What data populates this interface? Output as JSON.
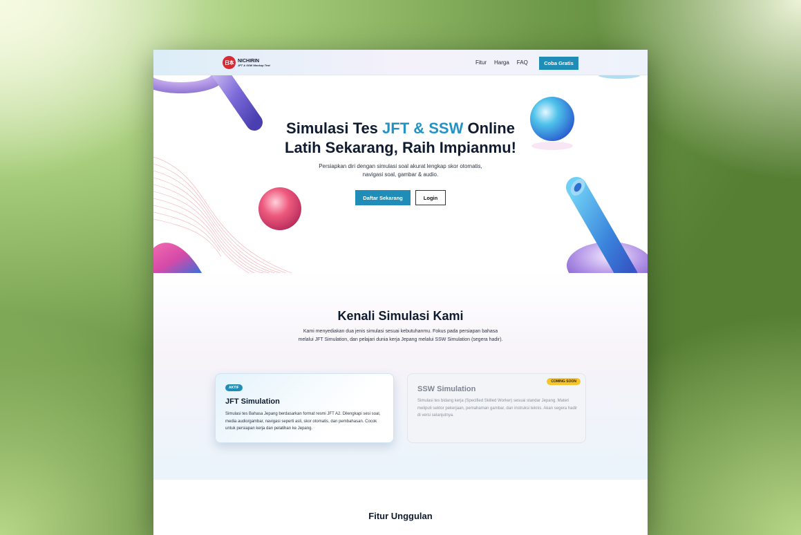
{
  "nav": {
    "logo_mark": "日本",
    "logo_name": "NICHIRIN",
    "logo_sub": "JFT & SSW Mockup Test",
    "links": [
      "Fitur",
      "Harga",
      "FAQ"
    ],
    "cta": "Coba Gratis"
  },
  "hero": {
    "title_prefix": "Simulasi Tes ",
    "title_accent": "JFT & SSW",
    "title_suffix": " Online",
    "title_line2": "Latih Sekarang, Raih Impianmu!",
    "subtitle_line1": "Persiapkan diri dengan simulasi soal akurat lengkap skor otomatis,",
    "subtitle_line2": "navigasi soal, gambar & audio.",
    "primary_button": "Daftar Sekarang",
    "secondary_button": "Login"
  },
  "about": {
    "title": "Kenali Simulasi Kami",
    "description": "Kami menyediakan dua jenis simulasi sesuai kebutuhanmu. Fokus pada persiapan bahasa melalui JFT Simulation, dan pelajari dunia kerja Jepang melalui SSW Simulation (segera hadir).",
    "cards": [
      {
        "badge": "AKTIF",
        "title": "JFT Simulation",
        "body": "Simulasi tes Bahasa Jepang berdasarkan format resmi JFT A2. Dilengkapi sesi soal, media audio/gambar, navigasi seperti asli, skor otomatis, dan pembahasan. Cocok untuk persiapan kerja dan pelatihan ke Jepang."
      },
      {
        "badge": "COMING SOON",
        "title": "SSW Simulation",
        "body": "Simulasi tes bidang kerja (Specified Skilled Worker) sesuai standar Jepang. Materi meliputi sektor pekerjaan, pemahaman gambar, dan instruksi teknis. Akan segera hadir di versi selanjutnya."
      }
    ]
  },
  "features": {
    "title": "Fitur Unggulan"
  },
  "colors": {
    "accent": "#2393c6",
    "button": "#1f8db8",
    "badge_soon": "#f7c52b",
    "logo_red": "#d62a35"
  }
}
